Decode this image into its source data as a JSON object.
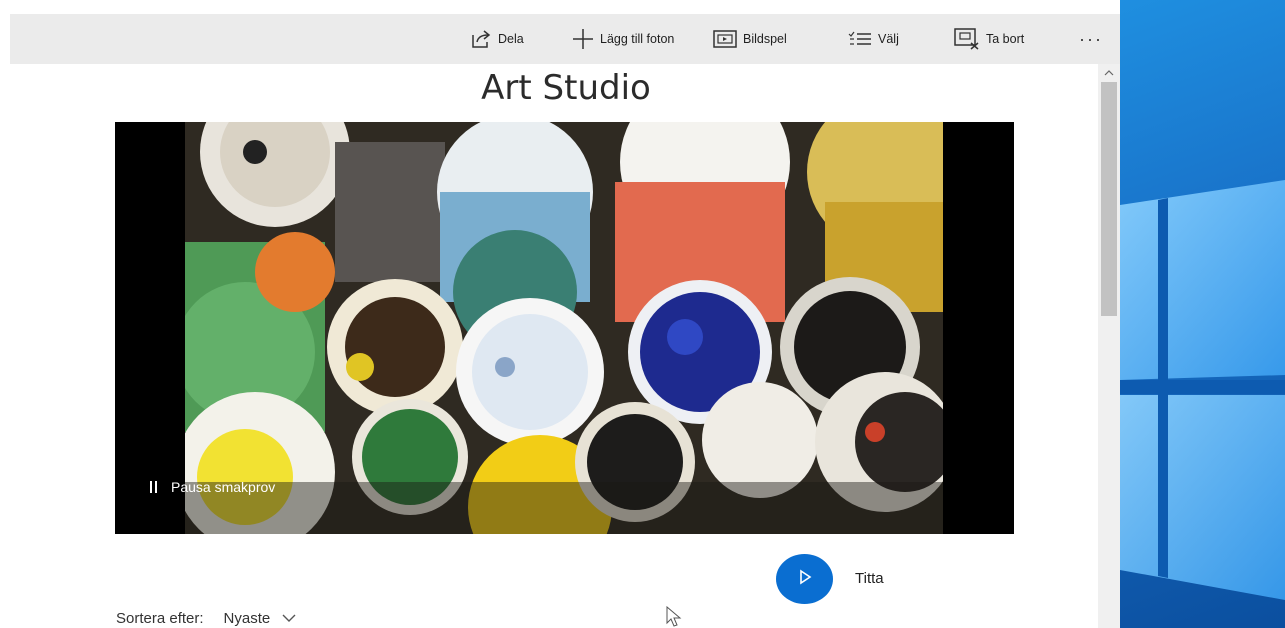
{
  "toolbar": {
    "share_label": "Dela",
    "add_photos_label": "Lägg till foton",
    "slideshow_label": "Bildspel",
    "select_label": "Välj",
    "remove_label": "Ta bort",
    "more_label": "···"
  },
  "album": {
    "title": "Art Studio",
    "preview_control_label": "Pausa smakprov",
    "watch_label": "Titta"
  },
  "sort": {
    "label": "Sortera efter:",
    "value": "Nyaste"
  },
  "colors": {
    "accent": "#0a6ed1",
    "toolbar_bg": "#ebebeb",
    "desktop_blue": "#1870c7"
  }
}
